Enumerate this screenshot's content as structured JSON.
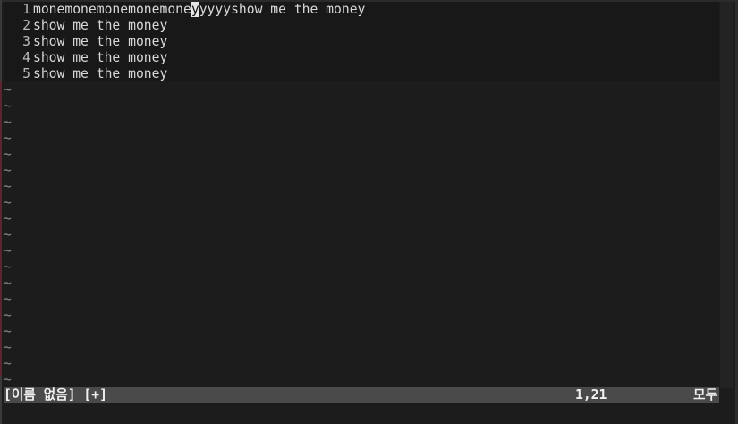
{
  "editor": {
    "lines": [
      {
        "number": "1",
        "before": "monemonemonemonemone",
        "cursor_char": "y",
        "after": "yyyyshow me the money"
      },
      {
        "number": "2",
        "text": "show me the money"
      },
      {
        "number": "3",
        "text": "show me the money"
      },
      {
        "number": "4",
        "text": "show me the money"
      },
      {
        "number": "5",
        "text": "show me the money"
      }
    ],
    "empty_line_marker": "~"
  },
  "statusline": {
    "filename": "[이름 없음] [+]",
    "position": "1,21",
    "scroll": "모두"
  },
  "colors": {
    "background": "#1c1c1c",
    "statusline_bg": "#4a4a4a",
    "text": "#d8d8d8",
    "cursor": "#e6e6e6"
  }
}
